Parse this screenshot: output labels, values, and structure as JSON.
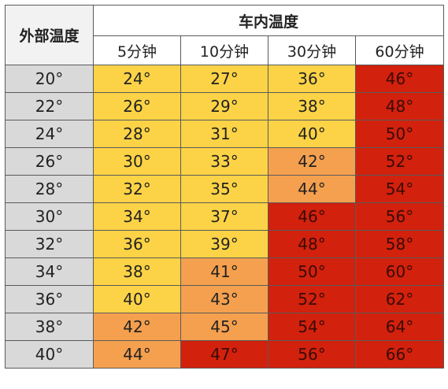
{
  "chart_data": {
    "type": "table",
    "corner_label": "外部温度",
    "group_label": "车内温度",
    "columns": [
      "5分钟",
      "10分钟",
      "30分钟",
      "60分钟"
    ],
    "rows": [
      {
        "outside": "20°",
        "values": [
          "24°",
          "27°",
          "36°",
          "46°"
        ],
        "levels": [
          "mild",
          "mild",
          "mild",
          "hot"
        ]
      },
      {
        "outside": "22°",
        "values": [
          "26°",
          "29°",
          "38°",
          "48°"
        ],
        "levels": [
          "mild",
          "mild",
          "mild",
          "hot"
        ]
      },
      {
        "outside": "24°",
        "values": [
          "28°",
          "31°",
          "40°",
          "50°"
        ],
        "levels": [
          "mild",
          "mild",
          "mild",
          "hot"
        ]
      },
      {
        "outside": "26°",
        "values": [
          "30°",
          "33°",
          "42°",
          "52°"
        ],
        "levels": [
          "mild",
          "mild",
          "warm",
          "hot"
        ]
      },
      {
        "outside": "28°",
        "values": [
          "32°",
          "35°",
          "44°",
          "54°"
        ],
        "levels": [
          "mild",
          "mild",
          "warm",
          "hot"
        ]
      },
      {
        "outside": "30°",
        "values": [
          "34°",
          "37°",
          "46°",
          "56°"
        ],
        "levels": [
          "mild",
          "mild",
          "hot",
          "hot"
        ]
      },
      {
        "outside": "32°",
        "values": [
          "36°",
          "39°",
          "48°",
          "58°"
        ],
        "levels": [
          "mild",
          "mild",
          "hot",
          "hot"
        ]
      },
      {
        "outside": "34°",
        "values": [
          "38°",
          "41°",
          "50°",
          "60°"
        ],
        "levels": [
          "mild",
          "warm",
          "hot",
          "hot"
        ]
      },
      {
        "outside": "36°",
        "values": [
          "40°",
          "43°",
          "52°",
          "62°"
        ],
        "levels": [
          "mild",
          "warm",
          "hot",
          "hot"
        ]
      },
      {
        "outside": "38°",
        "values": [
          "42°",
          "45°",
          "54°",
          "64°"
        ],
        "levels": [
          "warm",
          "warm",
          "hot",
          "hot"
        ]
      },
      {
        "outside": "40°",
        "values": [
          "44°",
          "47°",
          "56°",
          "66°"
        ],
        "levels": [
          "warm",
          "hot",
          "hot",
          "hot"
        ]
      }
    ],
    "colors": {
      "mild": "#fcd346",
      "warm": "#f5a04e",
      "hot": "#d2210d",
      "outside_column": "#d9d9d9",
      "corner": "#f2f2f2"
    }
  }
}
